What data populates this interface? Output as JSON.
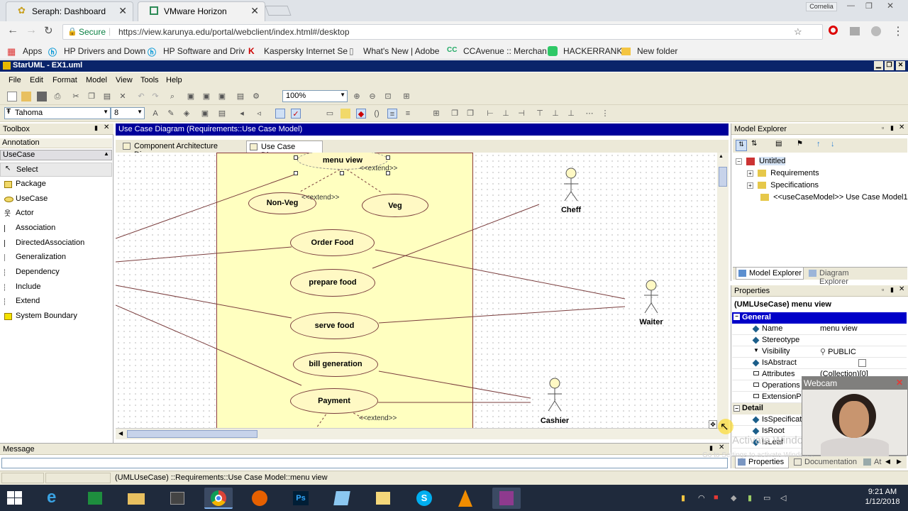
{
  "browser": {
    "tabs": [
      {
        "title": "Seraph: Dashboard"
      },
      {
        "title": "VMware Horizon"
      }
    ],
    "profile": "Cornelia",
    "secure_label": "Secure",
    "url": "https://view.karunya.edu/portal/webclient/index.html#/desktop",
    "bookmarks": [
      "Apps",
      "HP Drivers and Down",
      "HP Software and Driv",
      "Kaspersky Internet Se",
      "What's New | Adobe",
      "CCAvenue :: Merchan",
      "HACKERRANK",
      "New folder"
    ]
  },
  "app": {
    "title": "StarUML - EX1.uml",
    "menu": [
      "File",
      "Edit",
      "Format",
      "Model",
      "View",
      "Tools",
      "Help"
    ],
    "zoom": "100%",
    "font_name": "Tahoma",
    "font_size": "8"
  },
  "toolbox": {
    "title": "Toolbox",
    "sections": [
      "Annotation",
      "UseCase"
    ],
    "items": [
      "Select",
      "Package",
      "UseCase",
      "Actor",
      "Association",
      "DirectedAssociation",
      "Generalization",
      "Dependency",
      "Include",
      "Extend",
      "System Boundary"
    ]
  },
  "diagram": {
    "title": "Use Case Diagram (Requirements::Use Case Model)",
    "tabs": [
      "Component Architecture Diagram",
      "Use Case Diagram"
    ],
    "usecases": [
      "menu view",
      "Non-Veg",
      "Veg",
      "Order Food",
      "prepare food",
      "serve food",
      "bill generation",
      "Payment"
    ],
    "stereotype": "<<extend>>",
    "actors": [
      "Cheff",
      "Waiter",
      "Cashier"
    ]
  },
  "model_explorer": {
    "title": "Model Explorer",
    "root": "Untitled",
    "children": [
      "Requirements",
      "Specifications",
      "<<useCaseModel>> Use Case Model1"
    ],
    "tabs": [
      "Model Explorer",
      "Diagram Explorer"
    ]
  },
  "properties": {
    "title": "Properties",
    "header": "(UMLUseCase) menu view",
    "section_general": "General",
    "rows": [
      {
        "name": "Name",
        "value": "menu view"
      },
      {
        "name": "Stereotype",
        "value": ""
      },
      {
        "name": "Visibility",
        "value": "PUBLIC"
      },
      {
        "name": "IsAbstract",
        "value": ""
      },
      {
        "name": "Attributes",
        "value": "(Collection)[0]"
      },
      {
        "name": "Operations",
        "value": ""
      },
      {
        "name": "ExtensionPo",
        "value": ""
      }
    ],
    "section_detail": "Detail",
    "detail_rows": [
      "IsSpecification",
      "IsRoot",
      "IsLeaf"
    ],
    "tabs": [
      "Properties",
      "Documentation",
      "At"
    ]
  },
  "message": {
    "title": "Message"
  },
  "status": {
    "text": "(UMLUseCase) ::Requirements::Use Case Model::menu view"
  },
  "webcam": {
    "label": "Webcam"
  },
  "watermark": {
    "line1": "Activate Windows",
    "line2": "Go to Settings to activate Windows."
  },
  "clock": {
    "time": "9:21 AM",
    "date": "1/12/2018"
  }
}
